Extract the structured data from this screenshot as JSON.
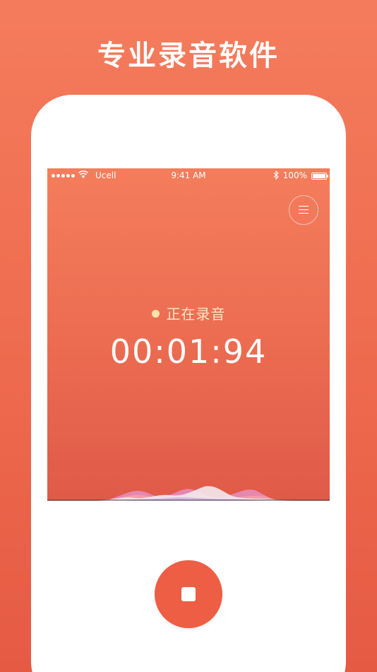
{
  "promo": {
    "title": "专业录音软件"
  },
  "status_bar": {
    "carrier": "Ucell",
    "time": "9:41 AM",
    "battery": "100%"
  },
  "recorder": {
    "status_text": "正在录音",
    "timer": "00:01:94"
  },
  "icons": {
    "menu": "menu-icon",
    "stop": "stop-icon",
    "wifi": "wifi-icon",
    "bluetooth": "bluetooth-icon",
    "battery": "battery-icon"
  },
  "colors": {
    "background": "#f07357",
    "accent": "#ed5e45",
    "status_text": "#fbe5c6",
    "white": "#ffffff"
  }
}
